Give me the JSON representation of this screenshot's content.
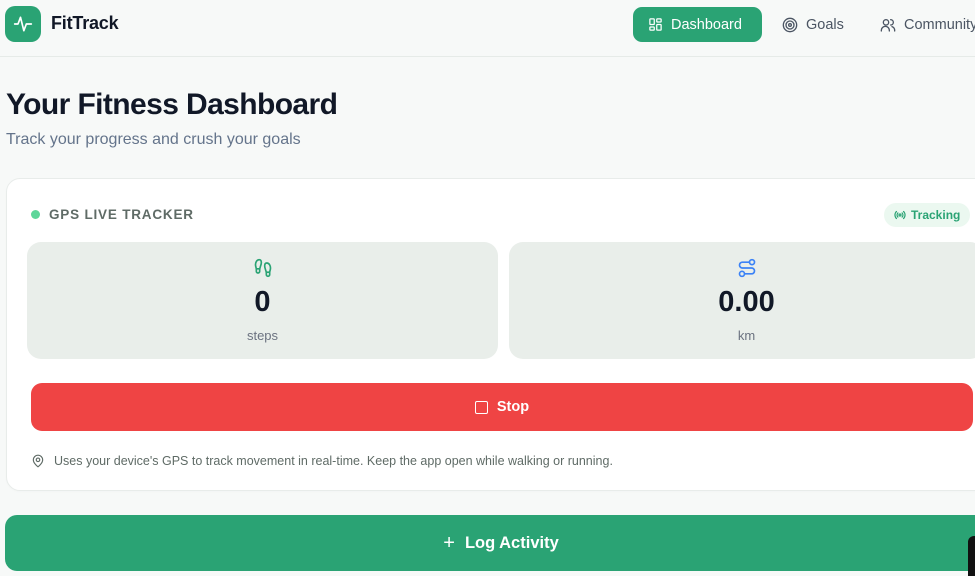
{
  "header": {
    "brand": "FitTrack",
    "nav": [
      {
        "label": "Dashboard",
        "active": true,
        "icon": "grid-icon"
      },
      {
        "label": "Goals",
        "active": false,
        "icon": "target-icon"
      },
      {
        "label": "Community",
        "active": false,
        "icon": "users-icon"
      }
    ]
  },
  "page": {
    "title": "Your Fitness Dashboard",
    "subtitle": "Track your progress and crush your goals"
  },
  "tracker": {
    "title": "GPS LIVE TRACKER",
    "status": "Tracking",
    "steps": {
      "value": "0",
      "unit": "steps",
      "icon": "footprints-icon"
    },
    "distance": {
      "value": "0.00",
      "unit": "km",
      "icon": "route-icon"
    },
    "stop_label": "Stop",
    "hint": "Uses your device's GPS to track movement in real-time. Keep the app open while walking or running."
  },
  "actions": {
    "log_activity": "Log Activity"
  },
  "colors": {
    "brand": "#2aa374",
    "danger": "#ef4444",
    "distance_icon": "#3b82f6"
  }
}
